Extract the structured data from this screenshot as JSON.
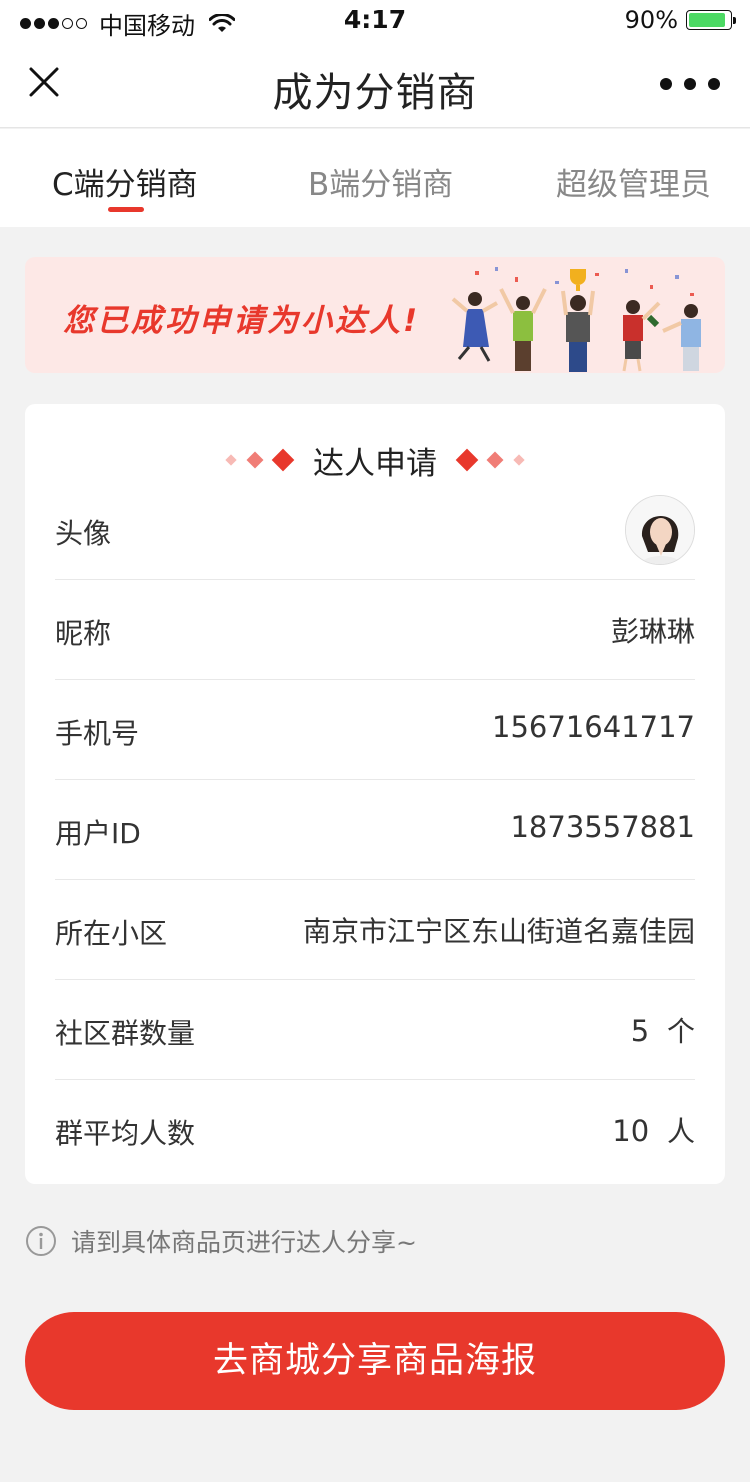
{
  "status_bar": {
    "carrier": "中国移动",
    "time": "4:17",
    "battery_percent": "90%",
    "battery_level": 0.9,
    "battery_color": "#4cd964"
  },
  "nav": {
    "title": "成为分销商",
    "close_icon": "close-icon",
    "more_icon": "more-icon"
  },
  "tabs": [
    {
      "label": "C端分销商",
      "active": true
    },
    {
      "label": "B端分销商",
      "active": false
    },
    {
      "label": "超级管理员",
      "active": false
    }
  ],
  "banner": {
    "text": "您已成功申请为小达人!"
  },
  "card": {
    "title": "达人申请",
    "rows": [
      {
        "label": "头像",
        "value": null
      },
      {
        "label": "昵称",
        "value": "彭琳琳"
      },
      {
        "label": "手机号",
        "value": "15671641717"
      },
      {
        "label": "用户ID",
        "value": "1873557881"
      },
      {
        "label": "所在小区",
        "value": "南京市江宁区东山街道名嘉佳园"
      },
      {
        "label": "社区群数量",
        "value": "5",
        "unit": "个"
      },
      {
        "label": "群平均人数",
        "value": "10",
        "unit": "人"
      }
    ]
  },
  "tip": {
    "icon": "info-icon",
    "text": "请到具体商品页进行达人分享~"
  },
  "cta": {
    "label": "去商城分享商品海报"
  },
  "colors": {
    "accent": "#e8382c",
    "background": "#f2f2f2",
    "banner_bg": "#fde8e6"
  }
}
